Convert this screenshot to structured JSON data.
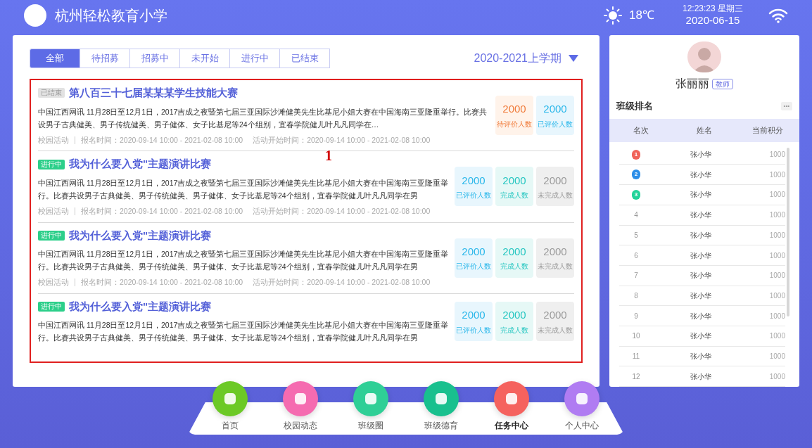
{
  "header": {
    "school": "杭州轻松教育小学",
    "weather": "18℃",
    "time": "12:23:23 星期三",
    "date": "2020-06-15"
  },
  "tabs": [
    {
      "label": "全部",
      "selected": true
    },
    {
      "label": "待招募",
      "selected": false
    },
    {
      "label": "招募中",
      "selected": false
    },
    {
      "label": "未开始",
      "selected": false
    },
    {
      "label": "进行中",
      "selected": false
    },
    {
      "label": "已结束",
      "selected": false
    }
  ],
  "term": "2020-2021上学期",
  "annotation": {
    "label": "1"
  },
  "activities": [
    {
      "status": {
        "kind": "ended",
        "label": "已结束"
      },
      "title": "第八百三十七届某某某学生技能大赛",
      "description": "中国江西网讯 11月28日至12月1日，2017吉成之夜暨第七届三亚国际沙滩健美先生比基尼小姐大赛在中国海南三亚隆重举行。比赛共设男子古典健美、男子传统健美、男子健体、女子比基尼等24个组别，宜春学院健儿叶凡凡同学在…",
      "category": "校园活动",
      "signup": "报名时间：2020-09-14 10:00 - 2021-02-08 10:00",
      "start": "活动开始时间：2020-09-14 10:00 - 2021-02-08 10:00",
      "stats": [
        {
          "kind": "pending",
          "value": "2000",
          "label": "待评价人数"
        },
        {
          "kind": "rated",
          "value": "2000",
          "label": "已评价人数"
        }
      ]
    },
    {
      "status": {
        "kind": "ongoing",
        "label": "进行中"
      },
      "title": "我为什么要入党\"主题演讲比赛",
      "description": "中国江西网讯 11月28日至12月1日，2017吉成之夜暨第七届三亚国际沙滩健美先生比基尼小姐大赛在中国海南三亚隆重举行。比赛共设男子古典健美、男子传统健美、男子健体、女子比基尼等24个组别，宜春学院健儿叶凡凡同学在男",
      "category": "校园活动",
      "signup": "报名时间：2020-09-14 10:00 - 2021-02-08 10:00",
      "start": "活动开始时间：2020-09-14 10:00 - 2021-02-08 10:00",
      "stats": [
        {
          "kind": "rated",
          "value": "2000",
          "label": "已评价人数"
        },
        {
          "kind": "done",
          "value": "2000",
          "label": "完成人数"
        },
        {
          "kind": "undone",
          "value": "2000",
          "label": "未完成人数"
        }
      ]
    },
    {
      "status": {
        "kind": "ongoing",
        "label": "进行中"
      },
      "title": "我为什么要入党\"主题演讲比赛",
      "description": "中国江西网讯 11月28日至12月1日，2017吉成之夜暨第七届三亚国际沙滩健美先生比基尼小姐大赛在中国海南三亚隆重举行。比赛共设男子古典健美、男子传统健美、男子健体、女子比基尼等24个组别，宜春学院健儿叶凡凡同学在男",
      "category": "校园活动",
      "signup": "报名时间：2020-09-14 10:00 - 2021-02-08 10:00",
      "start": "活动开始时间：2020-09-14 10:00 - 2021-02-08 10:00",
      "stats": [
        {
          "kind": "rated",
          "value": "2000",
          "label": "已评价人数"
        },
        {
          "kind": "done",
          "value": "2000",
          "label": "完成人数"
        },
        {
          "kind": "undone",
          "value": "2000",
          "label": "未完成人数"
        }
      ]
    },
    {
      "status": {
        "kind": "ongoing",
        "label": "进行中"
      },
      "title": "我为什么要入党\"主题演讲比赛",
      "description": "中国江西网讯 11月28日至12月1日，2017吉成之夜暨第七届三亚国际沙滩健美先生比基尼小姐大赛在中国海南三亚隆重举行。比赛共设男子古典健美、男子传统健美、男子健体、女子比基尼等24个组别，宜春学院健儿叶凡凡同学在男",
      "stats": [
        {
          "kind": "rated",
          "value": "2000",
          "label": "已评价人数"
        },
        {
          "kind": "done",
          "value": "2000",
          "label": "完成人数"
        },
        {
          "kind": "undone",
          "value": "2000",
          "label": "未完成人数"
        }
      ]
    }
  ],
  "profile": {
    "name": "张丽丽",
    "role": "教师"
  },
  "ranking": {
    "title": "班级排名",
    "more": "•••",
    "columns": [
      "名次",
      "姓名",
      "当前积分"
    ],
    "rows": [
      {
        "rank": "1",
        "name": "张小华",
        "score": "1000",
        "color": "#f0635a"
      },
      {
        "rank": "2",
        "name": "张小华",
        "score": "1000",
        "color": "#2b8ee8"
      },
      {
        "rank": "3",
        "name": "张小华",
        "score": "1000",
        "color": "#22d39a"
      },
      {
        "rank": "4",
        "name": "张小华",
        "score": "1000"
      },
      {
        "rank": "5",
        "name": "张小华",
        "score": "1000"
      },
      {
        "rank": "6",
        "name": "张小华",
        "score": "1000"
      },
      {
        "rank": "7",
        "name": "张小华",
        "score": "1000"
      },
      {
        "rank": "8",
        "name": "张小华",
        "score": "1000"
      },
      {
        "rank": "9",
        "name": "张小华",
        "score": "1000"
      },
      {
        "rank": "10",
        "name": "张小华",
        "score": "1000"
      },
      {
        "rank": "11",
        "name": "张小华",
        "score": "1000"
      },
      {
        "rank": "12",
        "name": "张小华",
        "score": "1000"
      }
    ]
  },
  "nav": [
    {
      "label": "首页",
      "color": "#6cc926",
      "selected": false
    },
    {
      "label": "校园动态",
      "color": "#f56bb0",
      "selected": false
    },
    {
      "label": "班级圈",
      "color": "#2fcf96",
      "selected": false
    },
    {
      "label": "班级德育",
      "color": "#19c08e",
      "selected": false
    },
    {
      "label": "任务中心",
      "color": "#f5625e",
      "selected": true
    },
    {
      "label": "个人中心",
      "color": "#b07cf2",
      "selected": false
    }
  ]
}
